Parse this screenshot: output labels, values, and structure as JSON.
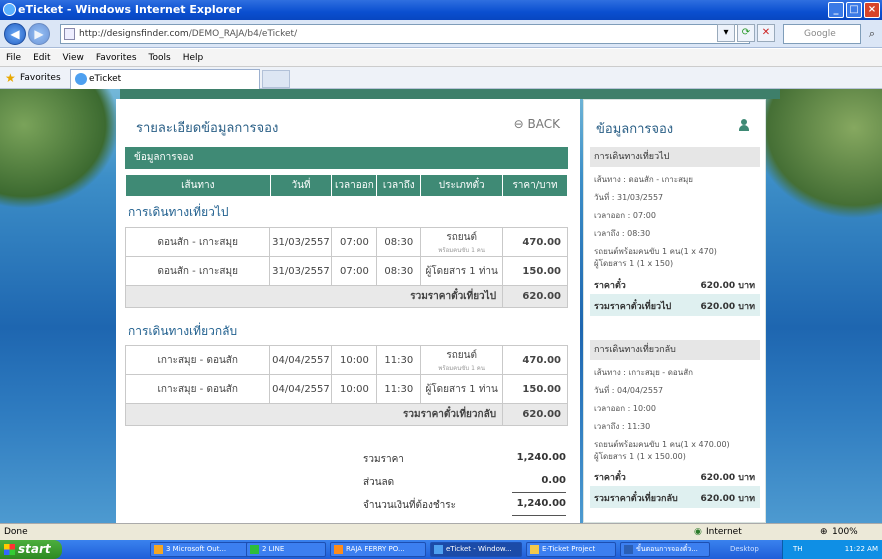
{
  "window": {
    "title": "eTicket - Windows Internet Explorer"
  },
  "address": {
    "url_host": "http://designsfinder.com",
    "url_path": "/DEMO_RAJA/b4/eTicket/",
    "search_placeholder": "Google"
  },
  "menu": [
    "File",
    "Edit",
    "View",
    "Favorites",
    "Tools",
    "Help"
  ],
  "favorites": {
    "label": "Favorites",
    "tab": "eTicket"
  },
  "main": {
    "title": "รายละเอียดข้อมูลการจอง",
    "back": "BACK",
    "section": "ข้อมูลการจอง",
    "columns": [
      "เส้นทาง",
      "วันที่",
      "เวลาออก",
      "เวลาถึง",
      "ประเภทตั๋ว",
      "ราคา/บาท"
    ],
    "outbound": {
      "heading": "การเดินทางเที่ยวไป",
      "rows": [
        {
          "route": "ดอนสัก - เกาะสมุย",
          "date": "31/03/2557",
          "dep": "07:00",
          "arr": "08:30",
          "type": "รถยนต์",
          "type_sub": "พร้อมคนขับ 1 คน",
          "price": "470.00"
        },
        {
          "route": "ดอนสัก - เกาะสมุย",
          "date": "31/03/2557",
          "dep": "07:00",
          "arr": "08:30",
          "type": "ผู้โดยสาร 1 ท่าน",
          "type_sub": "",
          "price": "150.00"
        }
      ],
      "subtotal_label": "รวมราคาตั๋วเที่ยวไป",
      "subtotal": "620.00"
    },
    "return": {
      "heading": "การเดินทางเที่ยวกลับ",
      "rows": [
        {
          "route": "เกาะสมุย - ดอนสัก",
          "date": "04/04/2557",
          "dep": "10:00",
          "arr": "11:30",
          "type": "รถยนต์",
          "type_sub": "พร้อมคนขับ 1 คน",
          "price": "470.00"
        },
        {
          "route": "เกาะสมุย - ดอนสัก",
          "date": "04/04/2557",
          "dep": "10:00",
          "arr": "11:30",
          "type": "ผู้โดยสาร 1 ท่าน",
          "type_sub": "",
          "price": "150.00"
        }
      ],
      "subtotal_label": "รวมราคาตั๋วเที่ยวกลับ",
      "subtotal": "620.00"
    },
    "totals": {
      "total_label": "รวมราคา",
      "total": "1,240.00",
      "discount_label": "ส่วนลด",
      "discount": "0.00",
      "pay_label": "จำนวนเงินที่ต้องชำระ",
      "pay": "1,240.00"
    }
  },
  "side": {
    "title": "ข้อมูลการจอง",
    "out": {
      "head": "การเดินทางเที่ยวไป",
      "route": "เส้นทาง : ดอนสัก - เกาะสมุย",
      "date": "วันที่ : 31/03/2557",
      "dep": "เวลาออก : 07:00",
      "arr": "เวลาถึง : 08:30",
      "car": "รถยนต์พร้อมคนขับ 1 คน(1 x 470)",
      "pax": "ผู้โดยสาร 1 (1 x 150)",
      "price_label": "ราคาตั๋ว",
      "price": "620.00 บาท",
      "total_label": "รวมราคาตั๋วเที่ยวไป",
      "total": "620.00 บาท"
    },
    "ret": {
      "head": "การเดินทางเที่ยวกลับ",
      "route": "เส้นทาง : เกาะสมุย - ดอนสัก",
      "date": "วันที่ : 04/04/2557",
      "dep": "เวลาออก : 10:00",
      "arr": "เวลาถึง : 11:30",
      "car": "รถยนต์พร้อมคนขับ 1 คน(1 x 470.00)",
      "pax": "ผู้โดยสาร 1 (1 x 150.00)",
      "price_label": "ราคาตั๋ว",
      "price": "620.00 บาท",
      "total_label": "รวมราคาตั๋วเที่ยวกลับ",
      "total": "620.00 บาท"
    }
  },
  "status": {
    "left": "Done",
    "zone": "Internet",
    "zoom": "100%"
  },
  "taskbar": {
    "start": "start",
    "items": [
      "3 Microsoft Out...",
      "2 LINE",
      "RAJA FERRY PO...",
      "eTicket - Window...",
      "E-Ticket Project",
      "ขั้นตอนการจองตั๋ว..."
    ],
    "desktop": "Desktop",
    "lang": "TH",
    "time": "11:22 AM"
  }
}
